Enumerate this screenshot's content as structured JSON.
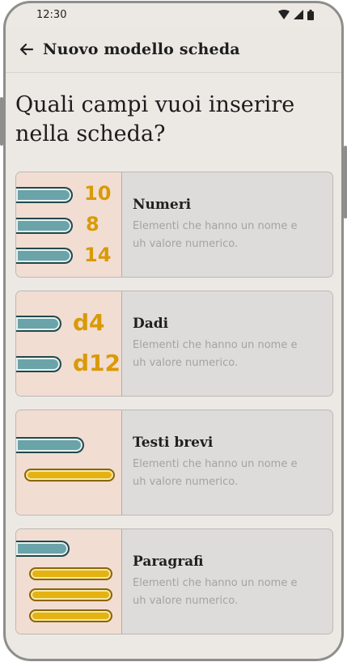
{
  "status_bar": {
    "time": "12:30"
  },
  "app_bar": {
    "title": "Nuovo modello scheda",
    "back_icon": "arrow-left-icon"
  },
  "question": {
    "line1": "Quali campi vuoi inserire",
    "line2": "nella scheda?"
  },
  "cards": [
    {
      "title": "Numeri",
      "desc_line1": "Elementi che hanno un nome e",
      "desc_line2": "uh valore numerico.",
      "values": [
        "10",
        "8",
        "14"
      ]
    },
    {
      "title": "Dadi",
      "desc_line1": "Elementi che hanno un nome e",
      "desc_line2": "uh valore numerico.",
      "values": [
        "d4",
        "d12"
      ]
    },
    {
      "title": "Testi brevi",
      "desc_line1": "Elementi che hanno un nome e",
      "desc_line2": "uh valore numerico."
    },
    {
      "title": "Paragrafi",
      "desc_line1": "Elementi che hanno un nome e",
      "desc_line2": "uh valore numerico."
    }
  ],
  "colors": {
    "teal_bar": "#6aa3a8",
    "gold_bar": "#e4b312",
    "number_gold": "#d99a06",
    "illustration_bg": "#f2ddd3"
  }
}
